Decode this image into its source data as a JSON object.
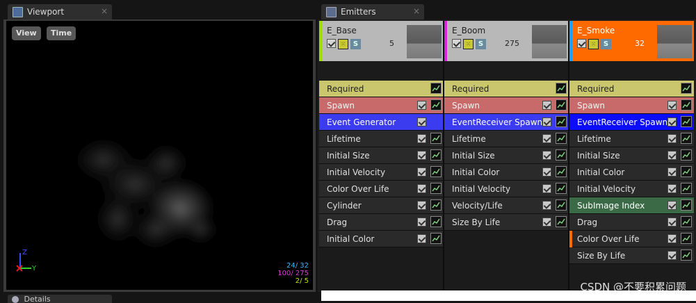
{
  "viewport_tab": {
    "label": "Viewport",
    "close": "×"
  },
  "emitters_tab": {
    "label": "Emitters",
    "close": "×"
  },
  "viewport": {
    "view_button": "View",
    "time_button": "Time",
    "axis": {
      "z": "Z",
      "y": "Y"
    },
    "stats": [
      {
        "text": "24/ 32",
        "color": "#3fb6ff"
      },
      {
        "text": "100/ 275",
        "color": "#d93fd9"
      },
      {
        "text": "2/ 5",
        "color": "#c8e000"
      }
    ]
  },
  "details_tab": {
    "label": "Details"
  },
  "emitters": [
    {
      "name": "E_Base",
      "count": "5",
      "bar_color": "#9be000",
      "header_bg": "#b8b8b8",
      "name_color": "#222",
      "modules": [
        {
          "label": "Required",
          "bg": "#c9c66e",
          "fg": "#222",
          "checkbox": false
        },
        {
          "label": "Spawn",
          "bg": "#c86a6a",
          "fg": "#f3f3f3",
          "checkbox": true
        },
        {
          "label": "Event Generator",
          "bg": "#3b3bef",
          "fg": "#ffffff",
          "checkbox": true,
          "graph": false
        },
        {
          "label": "Lifetime",
          "bg": "#2a2a2a",
          "fg": "#e0e0e0",
          "checkbox": true
        },
        {
          "label": "Initial Size",
          "bg": "#2a2a2a",
          "fg": "#e0e0e0",
          "checkbox": true
        },
        {
          "label": "Initial Velocity",
          "bg": "#2a2a2a",
          "fg": "#e0e0e0",
          "checkbox": true
        },
        {
          "label": "Color Over Life",
          "bg": "#2a2a2a",
          "fg": "#e0e0e0",
          "checkbox": true
        },
        {
          "label": "Cylinder",
          "bg": "#2a2a2a",
          "fg": "#e0e0e0",
          "checkbox": true
        },
        {
          "label": "Drag",
          "bg": "#2a2a2a",
          "fg": "#e0e0e0",
          "checkbox": true
        },
        {
          "label": "Initial Color",
          "bg": "#2a2a2a",
          "fg": "#e0e0e0",
          "checkbox": true
        }
      ]
    },
    {
      "name": "E_Boom",
      "count": "275",
      "bar_color": "#e020e0",
      "header_bg": "#b8b8b8",
      "name_color": "#222",
      "modules": [
        {
          "label": "Required",
          "bg": "#c9c66e",
          "fg": "#222",
          "checkbox": false
        },
        {
          "label": "Spawn",
          "bg": "#c86a6a",
          "fg": "#f3f3f3",
          "checkbox": true
        },
        {
          "label": "EventReceiver Spawn",
          "bg": "#3b3bef",
          "fg": "#ffffff",
          "checkbox": true
        },
        {
          "label": "Lifetime",
          "bg": "#2a2a2a",
          "fg": "#e0e0e0",
          "checkbox": true
        },
        {
          "label": "Initial Size",
          "bg": "#2a2a2a",
          "fg": "#e0e0e0",
          "checkbox": true
        },
        {
          "label": "Initial Color",
          "bg": "#2a2a2a",
          "fg": "#e0e0e0",
          "checkbox": true
        },
        {
          "label": "Initial Velocity",
          "bg": "#2a2a2a",
          "fg": "#e0e0e0",
          "checkbox": true
        },
        {
          "label": "Velocity/Life",
          "bg": "#2a2a2a",
          "fg": "#e0e0e0",
          "checkbox": true
        },
        {
          "label": "Size By Life",
          "bg": "#2a2a2a",
          "fg": "#e0e0e0",
          "checkbox": true
        }
      ]
    },
    {
      "name": "E_Smoke",
      "count": "32",
      "bar_color": "#19a0ff",
      "header_bg": "#ff6a00",
      "name_color": "#ffffff",
      "modules": [
        {
          "label": "Required",
          "bg": "#c9c66e",
          "fg": "#222",
          "checkbox": false
        },
        {
          "label": "Spawn",
          "bg": "#c86a6a",
          "fg": "#f3f3f3",
          "checkbox": true
        },
        {
          "label": "EventReceiver Spawn",
          "bg": "#0c0cff",
          "fg": "#ffffff",
          "checkbox": true
        },
        {
          "label": "Lifetime",
          "bg": "#2a2a2a",
          "fg": "#e0e0e0",
          "checkbox": true
        },
        {
          "label": "Initial Size",
          "bg": "#2a2a2a",
          "fg": "#e0e0e0",
          "checkbox": true
        },
        {
          "label": "Initial Color",
          "bg": "#2a2a2a",
          "fg": "#e0e0e0",
          "checkbox": true
        },
        {
          "label": "Initial Velocity",
          "bg": "#2a2a2a",
          "fg": "#e0e0e0",
          "checkbox": true
        },
        {
          "label": "SubImage Index",
          "bg": "#3b6b46",
          "fg": "#ffffff",
          "checkbox": true
        },
        {
          "label": "Drag",
          "bg": "#2a2a2a",
          "fg": "#e0e0e0",
          "checkbox": true
        },
        {
          "label": "Color Over Life",
          "bg": "#2a2a2a",
          "fg": "#e0e0e0",
          "checkbox": true,
          "marker": "#ff6a00"
        },
        {
          "label": "Size By Life",
          "bg": "#2a2a2a",
          "fg": "#e0e0e0",
          "checkbox": true
        }
      ]
    }
  ],
  "watermark": "CSDN @不要积累问题"
}
